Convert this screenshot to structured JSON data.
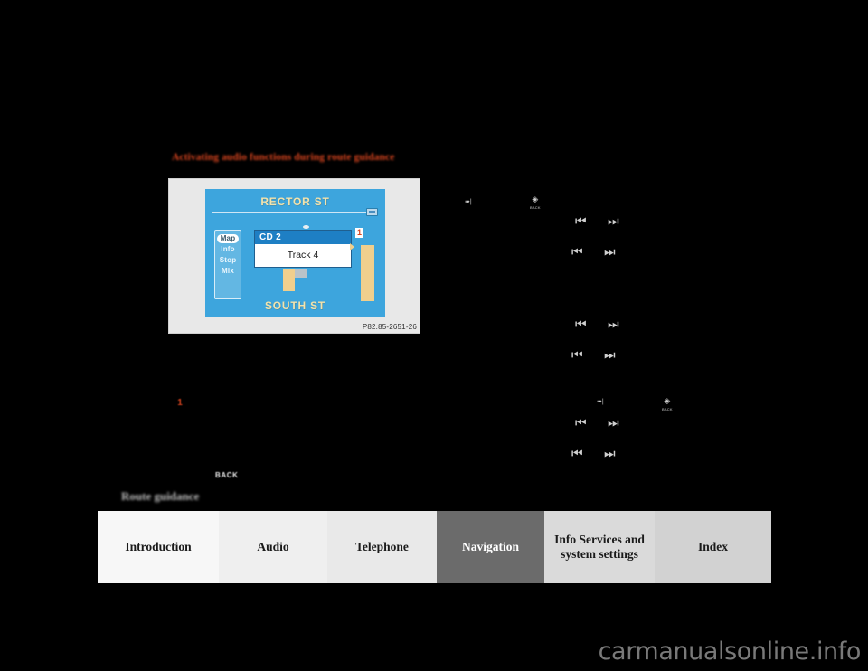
{
  "page": {
    "heading": "Activating audio functions during route guidance",
    "section_label": "Route guidance",
    "watermark": "carmanualsonline.info"
  },
  "figure": {
    "caption": "P82.85-2651-26",
    "callout_number": "1",
    "screen": {
      "street_top": "RECTOR ST",
      "street_bottom": "SOUTH ST",
      "side_menu": [
        {
          "label": "Map",
          "selected": true
        },
        {
          "label": "Info",
          "selected": false
        },
        {
          "label": "Stop",
          "selected": false
        },
        {
          "label": "Mix",
          "selected": false
        }
      ],
      "popup": {
        "title": "CD 2",
        "body": "Track  4"
      },
      "status_icon": "cassette-icon",
      "colors": {
        "screen_bg": "#3da5dd",
        "street_text": "#f2e3ae",
        "popup_title_bg": "#1e7fc4",
        "building": "#f0cf8d",
        "callout_red": "#d9451f"
      }
    }
  },
  "body": {
    "callout_number": "1",
    "back_key_label": "BACK"
  },
  "controls": {
    "glyphs": [
      {
        "name": "prev-track-icon",
        "char": "⏴|"
      },
      {
        "name": "next-track-icon",
        "char": "|⏵"
      }
    ],
    "skip_prev": "⏴",
    "skip_next": "⏵"
  },
  "tabs": [
    {
      "id": "introduction",
      "label": "Introduction",
      "active": false
    },
    {
      "id": "audio",
      "label": "Audio",
      "active": false
    },
    {
      "id": "telephone",
      "label": "Telephone",
      "active": false
    },
    {
      "id": "navigation",
      "label": "Navigation",
      "active": true
    },
    {
      "id": "info-services",
      "label": "Info Services and system settings",
      "active": false
    },
    {
      "id": "index",
      "label": "Index",
      "active": false
    }
  ]
}
